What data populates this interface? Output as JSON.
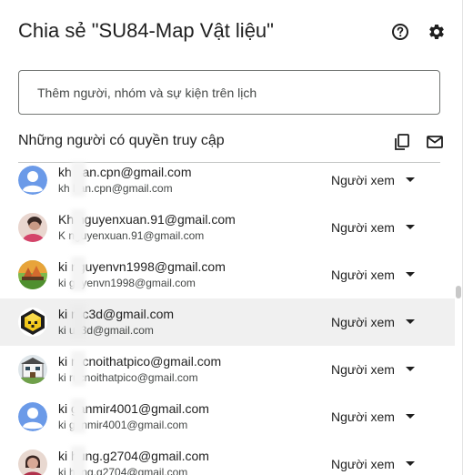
{
  "dialog": {
    "title": "Chia sẻ \"SU84-Map Vật liệu\"",
    "help_icon": "help-circle-icon",
    "settings_icon": "gear-icon"
  },
  "add_people": {
    "placeholder": "Thêm người, nhóm và sự kiện trên lịch"
  },
  "access_section": {
    "title": "Những người có quyền truy cập",
    "copy_icon": "copy-emails-icon",
    "email_icon": "mail-icon"
  },
  "people": [
    {
      "name": "kh han.cpn@gmail.com",
      "email": "kh han.cpn@gmail.com",
      "role": "Người xem",
      "avatar": "default-person"
    },
    {
      "name": "Kh nguyenxuan.91@gmail.com",
      "email": "K nguyenxuan.91@gmail.com",
      "role": "Người xem",
      "avatar": "photo"
    },
    {
      "name": "ki nguyenvn1998@gmail.com",
      "email": "ki guyenvn1998@gmail.com",
      "role": "Người xem",
      "avatar": "landscape"
    },
    {
      "name": "ki ruc3d@gmail.com",
      "email": "ki uc3d@gmail.com",
      "role": "Người xem",
      "avatar": "cube-logo"
    },
    {
      "name": "ki rucnoithatpico@gmail.com",
      "email": "ki rucnoithatpico@gmail.com",
      "role": "Người xem",
      "avatar": "building"
    },
    {
      "name": "ki ganmir4001@gmail.com",
      "email": "ki ganmir4001@gmail.com",
      "role": "Người xem",
      "avatar": "default-person"
    },
    {
      "name": "ki hung.g2704@gmail.com",
      "email": "ki hung.g2704@gmail.com",
      "role": "Người xem",
      "avatar": "photo"
    }
  ],
  "colors": {
    "default_avatar_bg": "#6b9ae8",
    "selected_row": "#f0f0f0",
    "text": "#1f1f1f",
    "secondary_text": "#444746"
  }
}
